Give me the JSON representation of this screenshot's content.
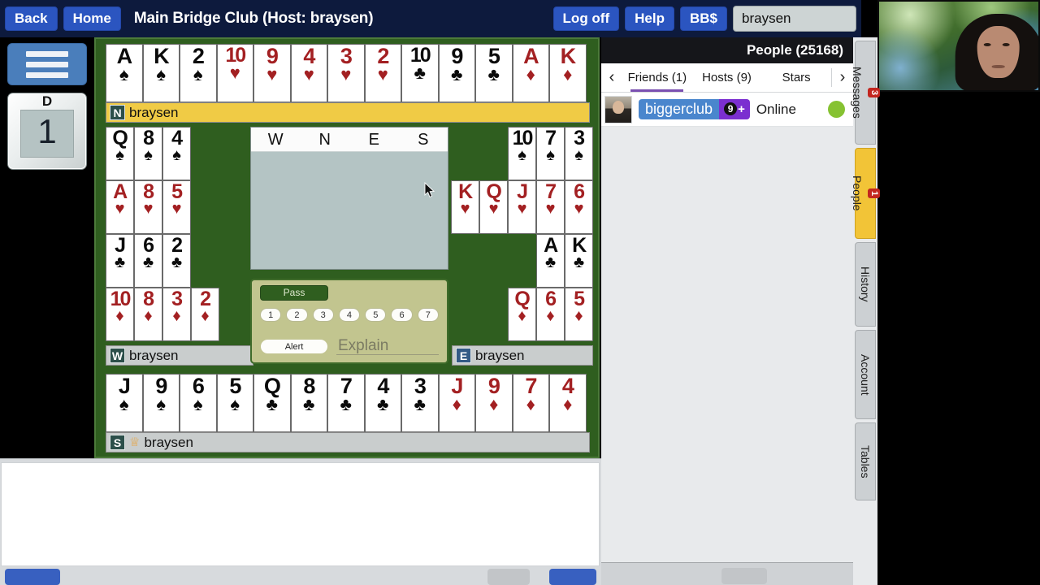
{
  "header": {
    "back_label": "Back",
    "home_label": "Home",
    "title": "Main Bridge Club (Host: braysen)",
    "logoff_label": "Log off",
    "help_label": "Help",
    "bbs_label": "BB$",
    "username": "braysen",
    "signal_icon": "signal-bars-icon"
  },
  "left_rail": {
    "menu_icon": "hamburger-menu-icon",
    "table_tag": "D",
    "table_number": "1"
  },
  "table": {
    "hands": {
      "north": {
        "seat": "N",
        "player": "braysen",
        "active": true,
        "rows": [
          [
            {
              "rank": "A",
              "suit": "♠",
              "color": "black"
            },
            {
              "rank": "K",
              "suit": "♠",
              "color": "black"
            },
            {
              "rank": "2",
              "suit": "♠",
              "color": "black"
            },
            {
              "rank": "10",
              "suit": "♥",
              "color": "red"
            },
            {
              "rank": "9",
              "suit": "♥",
              "color": "red"
            },
            {
              "rank": "4",
              "suit": "♥",
              "color": "red"
            },
            {
              "rank": "3",
              "suit": "♥",
              "color": "red"
            },
            {
              "rank": "2",
              "suit": "♥",
              "color": "red"
            },
            {
              "rank": "10",
              "suit": "♣",
              "color": "black"
            },
            {
              "rank": "9",
              "suit": "♣",
              "color": "black"
            },
            {
              "rank": "5",
              "suit": "♣",
              "color": "black"
            },
            {
              "rank": "A",
              "suit": "♦",
              "color": "red"
            },
            {
              "rank": "K",
              "suit": "♦",
              "color": "red"
            }
          ]
        ]
      },
      "west": {
        "seat": "W",
        "player": "braysen",
        "active": false,
        "rows": [
          [
            {
              "rank": "Q",
              "suit": "♠",
              "color": "black"
            },
            {
              "rank": "8",
              "suit": "♠",
              "color": "black"
            },
            {
              "rank": "4",
              "suit": "♠",
              "color": "black"
            }
          ],
          [
            {
              "rank": "A",
              "suit": "♥",
              "color": "red"
            },
            {
              "rank": "8",
              "suit": "♥",
              "color": "red"
            },
            {
              "rank": "5",
              "suit": "♥",
              "color": "red"
            }
          ],
          [
            {
              "rank": "J",
              "suit": "♣",
              "color": "black"
            },
            {
              "rank": "6",
              "suit": "♣",
              "color": "black"
            },
            {
              "rank": "2",
              "suit": "♣",
              "color": "black"
            }
          ],
          [
            {
              "rank": "10",
              "suit": "♦",
              "color": "red"
            },
            {
              "rank": "8",
              "suit": "♦",
              "color": "red"
            },
            {
              "rank": "3",
              "suit": "♦",
              "color": "red"
            },
            {
              "rank": "2",
              "suit": "♦",
              "color": "red"
            }
          ]
        ]
      },
      "east": {
        "seat": "E",
        "player": "braysen",
        "active": false,
        "rows": [
          [
            {
              "rank": "10",
              "suit": "♠",
              "color": "black"
            },
            {
              "rank": "7",
              "suit": "♠",
              "color": "black"
            },
            {
              "rank": "3",
              "suit": "♠",
              "color": "black"
            }
          ],
          [
            {
              "rank": "K",
              "suit": "♥",
              "color": "red"
            },
            {
              "rank": "Q",
              "suit": "♥",
              "color": "red"
            },
            {
              "rank": "J",
              "suit": "♥",
              "color": "red"
            },
            {
              "rank": "7",
              "suit": "♥",
              "color": "red"
            },
            {
              "rank": "6",
              "suit": "♥",
              "color": "red"
            }
          ],
          [
            {
              "rank": "A",
              "suit": "♣",
              "color": "black"
            },
            {
              "rank": "K",
              "suit": "♣",
              "color": "black"
            }
          ],
          [
            {
              "rank": "Q",
              "suit": "♦",
              "color": "red"
            },
            {
              "rank": "6",
              "suit": "♦",
              "color": "red"
            },
            {
              "rank": "5",
              "suit": "♦",
              "color": "red"
            }
          ]
        ]
      },
      "south": {
        "seat": "S",
        "player": "braysen",
        "active": false,
        "crown_icon": "crown-icon",
        "rows": [
          [
            {
              "rank": "J",
              "suit": "♠",
              "color": "black"
            },
            {
              "rank": "9",
              "suit": "♠",
              "color": "black"
            },
            {
              "rank": "6",
              "suit": "♠",
              "color": "black"
            },
            {
              "rank": "5",
              "suit": "♠",
              "color": "black"
            },
            {
              "rank": "Q",
              "suit": "♣",
              "color": "black"
            },
            {
              "rank": "8",
              "suit": "♣",
              "color": "black"
            },
            {
              "rank": "7",
              "suit": "♣",
              "color": "black"
            },
            {
              "rank": "4",
              "suit": "♣",
              "color": "black"
            },
            {
              "rank": "3",
              "suit": "♣",
              "color": "black"
            },
            {
              "rank": "J",
              "suit": "♦",
              "color": "red"
            },
            {
              "rank": "9",
              "suit": "♦",
              "color": "red"
            },
            {
              "rank": "7",
              "suit": "♦",
              "color": "red"
            },
            {
              "rank": "4",
              "suit": "♦",
              "color": "red"
            }
          ]
        ]
      }
    },
    "auction": {
      "columns": [
        "W",
        "N",
        "E",
        "S"
      ],
      "calls": []
    },
    "bidbox": {
      "pass_label": "Pass",
      "levels": [
        "1",
        "2",
        "3",
        "4",
        "5",
        "6",
        "7"
      ],
      "alert_label": "Alert",
      "explain_placeholder": "Explain"
    }
  },
  "right_panel": {
    "title": "People (25168)",
    "prev_icon": "chevron-left-icon",
    "next_icon": "chevron-right-icon",
    "tabs": [
      {
        "label": "Friends (1)",
        "active": true
      },
      {
        "label": "Hosts (9)",
        "active": false
      },
      {
        "label": "Stars",
        "active": false
      }
    ],
    "friends": [
      {
        "avatar_icon": "user-avatar",
        "name": "biggerclub",
        "badge": "9+",
        "status": "Online",
        "presence_icon": "online-dot"
      }
    ]
  },
  "vertical_tabs": [
    {
      "label": "Messages",
      "badge": "3",
      "active": false
    },
    {
      "label": "People",
      "badge": "1",
      "active": true
    },
    {
      "label": "History",
      "badge": "",
      "active": false
    },
    {
      "label": "Account",
      "badge": "",
      "active": false
    },
    {
      "label": "Tables",
      "badge": "",
      "active": false
    }
  ],
  "colors": {
    "header_bg": "#0d1a3d",
    "button_blue": "#2b55c0",
    "felt_green": "#2f5e1f",
    "active_gold": "#f0cb45",
    "tab_active": "#f2c437",
    "badge_red": "#c3261f",
    "online_green": "#86c232",
    "card_red": "#a32022"
  }
}
